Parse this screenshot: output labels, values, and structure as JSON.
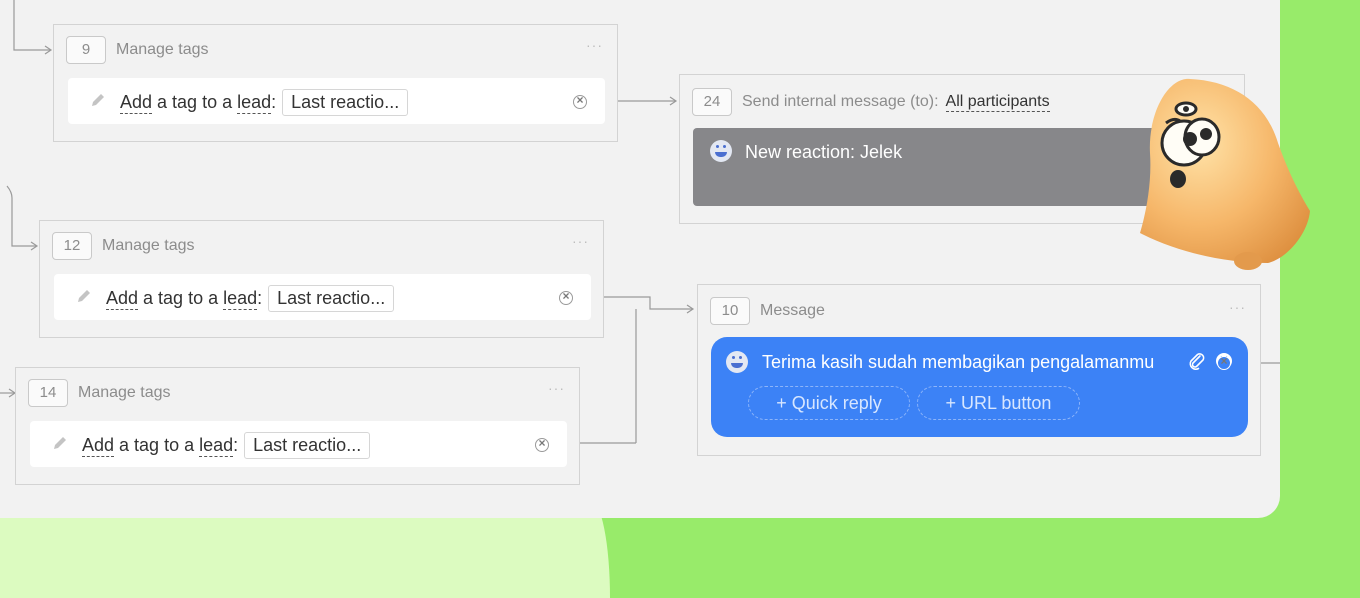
{
  "blocks": {
    "b9": {
      "number": "9",
      "title": "Manage tags",
      "menu": "···",
      "action": "Add",
      "mid": " a tag to a ",
      "target": "lead",
      "colon": ":",
      "value": "Last reactio..."
    },
    "b12": {
      "number": "12",
      "title": "Manage tags",
      "menu": "···",
      "action": "Add",
      "mid": " a tag to a ",
      "target": "lead",
      "colon": ":",
      "value": "Last reactio..."
    },
    "b14": {
      "number": "14",
      "title": "Manage tags",
      "menu": "···",
      "action": "Add",
      "mid": " a tag to a ",
      "target": "lead",
      "colon": ":",
      "value": "Last reactio..."
    },
    "b24": {
      "number": "24",
      "title": "Send internal message (to):",
      "recipients": "All participants",
      "message": "New reaction: Jelek"
    },
    "b10": {
      "number": "10",
      "title": "Message",
      "menu": "···",
      "message": "Terima kasih sudah membagikan pengalamanmu",
      "quick_reply": "+ Quick reply",
      "url_button": "+ URL button"
    }
  },
  "icons": {
    "edit": "pencil-icon",
    "remove": "close-circle-icon",
    "attach": "paperclip-icon",
    "bot": "bot-avatar-icon",
    "mascot": "bell-mascot"
  },
  "colors": {
    "message_blue": "#3c82f6",
    "internal_gray": "#87878a",
    "background_green": "#98eb6a",
    "canvas": "#f2f2f2"
  }
}
